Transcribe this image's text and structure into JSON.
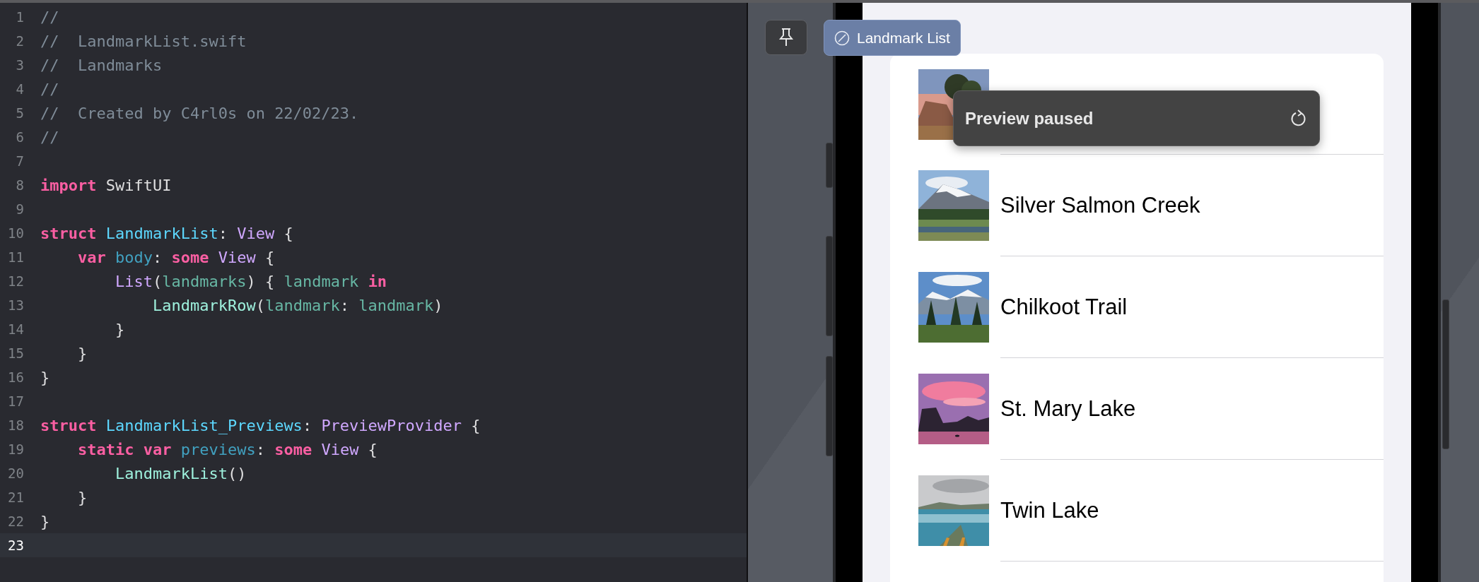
{
  "editor": {
    "lines": [
      {
        "number": "1",
        "current": false,
        "tokens": [
          {
            "kind": "comment",
            "text": "//"
          }
        ]
      },
      {
        "number": "2",
        "current": false,
        "tokens": [
          {
            "kind": "comment",
            "text": "//  LandmarkList.swift"
          }
        ]
      },
      {
        "number": "3",
        "current": false,
        "tokens": [
          {
            "kind": "comment",
            "text": "//  Landmarks"
          }
        ]
      },
      {
        "number": "4",
        "current": false,
        "tokens": [
          {
            "kind": "comment",
            "text": "//"
          }
        ]
      },
      {
        "number": "5",
        "current": false,
        "tokens": [
          {
            "kind": "comment",
            "text": "//  Created by C4rl0s on 22/02/23."
          }
        ]
      },
      {
        "number": "6",
        "current": false,
        "tokens": [
          {
            "kind": "comment",
            "text": "//"
          }
        ]
      },
      {
        "number": "7",
        "current": false
      },
      {
        "number": "8",
        "current": false,
        "tokens": [
          {
            "kind": "keyword",
            "text": "import"
          },
          {
            "kind": "plain",
            "text": " SwiftUI"
          }
        ]
      },
      {
        "number": "9",
        "current": false
      },
      {
        "number": "10",
        "current": false,
        "tokens": [
          {
            "kind": "keyword",
            "text": "struct "
          },
          {
            "kind": "declaration",
            "text": "LandmarkList"
          },
          {
            "kind": "plain",
            "text": ": "
          },
          {
            "kind": "type",
            "text": "View"
          },
          {
            "kind": "plain",
            "text": " {"
          }
        ]
      },
      {
        "number": "11",
        "current": false,
        "tokens": [
          {
            "kind": "keyword",
            "text": "    var "
          },
          {
            "kind": "property",
            "text": "body"
          },
          {
            "kind": "plain",
            "text": ": "
          },
          {
            "kind": "keyword",
            "text": "some "
          },
          {
            "kind": "type",
            "text": "View"
          },
          {
            "kind": "plain",
            "text": " {"
          }
        ]
      },
      {
        "number": "12",
        "current": false,
        "tokens": [
          {
            "kind": "type",
            "text": "        List"
          },
          {
            "kind": "plain",
            "text": "("
          },
          {
            "kind": "identifier",
            "text": "landmarks"
          },
          {
            "kind": "plain",
            "text": ") { "
          },
          {
            "kind": "identifier",
            "text": "landmark "
          },
          {
            "kind": "keyword",
            "text": "in"
          }
        ]
      },
      {
        "number": "13",
        "current": false,
        "tokens": [
          {
            "kind": "project",
            "text": "            LandmarkRow"
          },
          {
            "kind": "plain",
            "text": "("
          },
          {
            "kind": "identifier",
            "text": "landmark"
          },
          {
            "kind": "plain",
            "text": ": "
          },
          {
            "kind": "identifier",
            "text": "landmark"
          },
          {
            "kind": "plain",
            "text": ")"
          }
        ]
      },
      {
        "number": "14",
        "current": false,
        "tokens": [
          {
            "kind": "plain",
            "text": "        }"
          }
        ]
      },
      {
        "number": "15",
        "current": false,
        "tokens": [
          {
            "kind": "plain",
            "text": "    }"
          }
        ]
      },
      {
        "number": "16",
        "current": false,
        "tokens": [
          {
            "kind": "plain",
            "text": "}"
          }
        ]
      },
      {
        "number": "17",
        "current": false
      },
      {
        "number": "18",
        "current": false,
        "tokens": [
          {
            "kind": "keyword",
            "text": "struct "
          },
          {
            "kind": "declaration",
            "text": "LandmarkList_Previews"
          },
          {
            "kind": "plain",
            "text": ": "
          },
          {
            "kind": "type",
            "text": "PreviewProvider"
          },
          {
            "kind": "plain",
            "text": " {"
          }
        ]
      },
      {
        "number": "19",
        "current": false,
        "tokens": [
          {
            "kind": "keyword",
            "text": "    static var "
          },
          {
            "kind": "property",
            "text": "previews"
          },
          {
            "kind": "plain",
            "text": ": "
          },
          {
            "kind": "keyword",
            "text": "some "
          },
          {
            "kind": "type",
            "text": "View"
          },
          {
            "kind": "plain",
            "text": " {"
          }
        ]
      },
      {
        "number": "20",
        "current": false,
        "tokens": [
          {
            "kind": "project",
            "text": "        LandmarkList"
          },
          {
            "kind": "plain",
            "text": "()"
          }
        ]
      },
      {
        "number": "21",
        "current": false,
        "tokens": [
          {
            "kind": "plain",
            "text": "    }"
          }
        ]
      },
      {
        "number": "22",
        "current": false,
        "tokens": [
          {
            "kind": "plain",
            "text": "}"
          }
        ]
      },
      {
        "number": "23",
        "current": true
      }
    ]
  },
  "preview": {
    "preview_label": "Landmark List",
    "popup": {
      "title": "Preview paused"
    },
    "rows": [
      {
        "kind": "picture"
      },
      {
        "kind": "picture",
        "name": "Silver Salmon Creek"
      },
      {
        "kind": "picture",
        "name": "Chilkoot Trail"
      },
      {
        "kind": "picture",
        "name": "St. Mary Lake"
      },
      {
        "kind": "picture",
        "name": "Twin Lake"
      }
    ]
  }
}
